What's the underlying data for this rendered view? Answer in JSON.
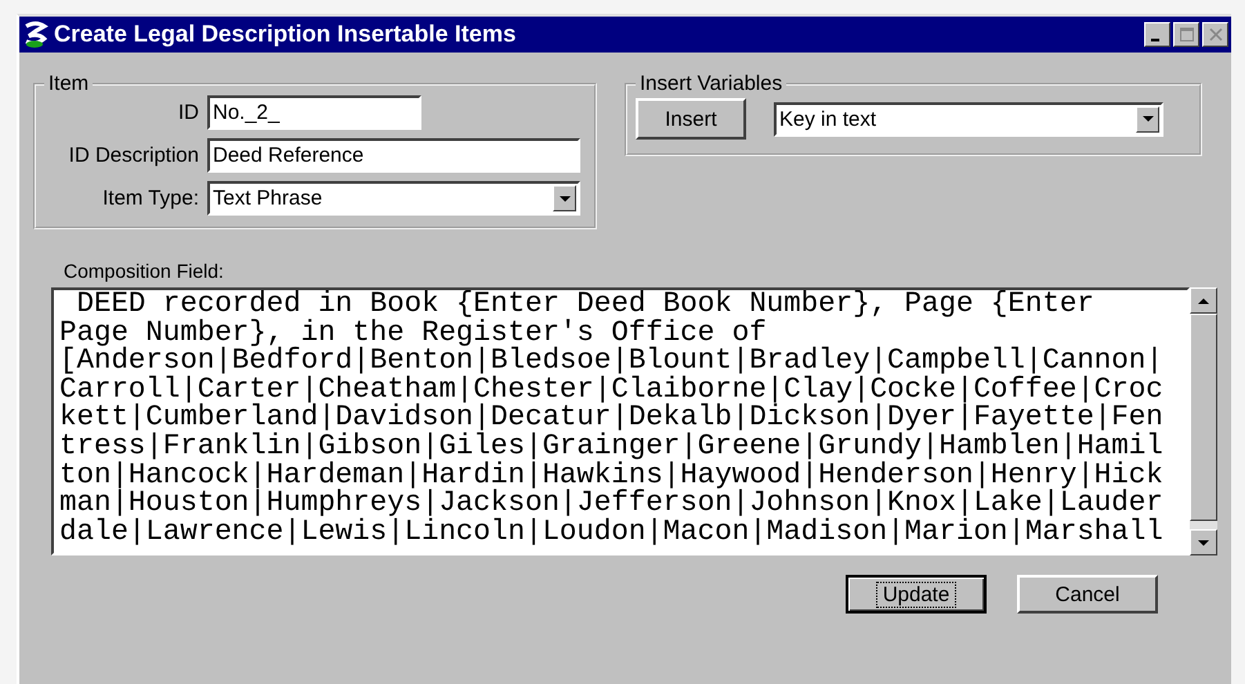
{
  "window": {
    "title": "Create Legal Description Insertable Items"
  },
  "item_group": {
    "label": "Item",
    "fields": [
      {
        "label": "ID",
        "value": "No._2_",
        "kind": "text"
      },
      {
        "label": "ID Description",
        "value": "Deed Reference",
        "kind": "text"
      },
      {
        "label": "Item Type:",
        "value": "Text Phrase",
        "kind": "dropdown"
      }
    ]
  },
  "insert_group": {
    "label": "Insert Variables",
    "button": "Insert",
    "dropdown_value": "Key in text"
  },
  "composition": {
    "label": "Composition Field:",
    "lines": [
      " DEED recorded in Book {Enter Deed Book Number}, Page {Enter",
      "Page Number}, in the Register's Office of",
      "[Anderson|Bedford|Benton|Bledsoe|Blount|Bradley|Campbell|Cannon|",
      "Carroll|Carter|Cheatham|Chester|Claiborne|Clay|Cocke|Coffee|Croc",
      "kett|Cumberland|Davidson|Decatur|Dekalb|Dickson|Dyer|Fayette|Fen",
      "tress|Franklin|Gibson|Giles|Grainger|Greene|Grundy|Hamblen|Hamil",
      "ton|Hancock|Hardeman|Hardin|Hawkins|Haywood|Henderson|Henry|Hick",
      "man|Houston|Humphreys|Jackson|Jefferson|Johnson|Knox|Lake|Lauder",
      "dale|Lawrence|Lewis|Lincoln|Loudon|Macon|Madison|Marion|Marshall"
    ]
  },
  "buttons": [
    {
      "label": "Update",
      "focused": true
    },
    {
      "label": "Cancel",
      "focused": false
    }
  ]
}
